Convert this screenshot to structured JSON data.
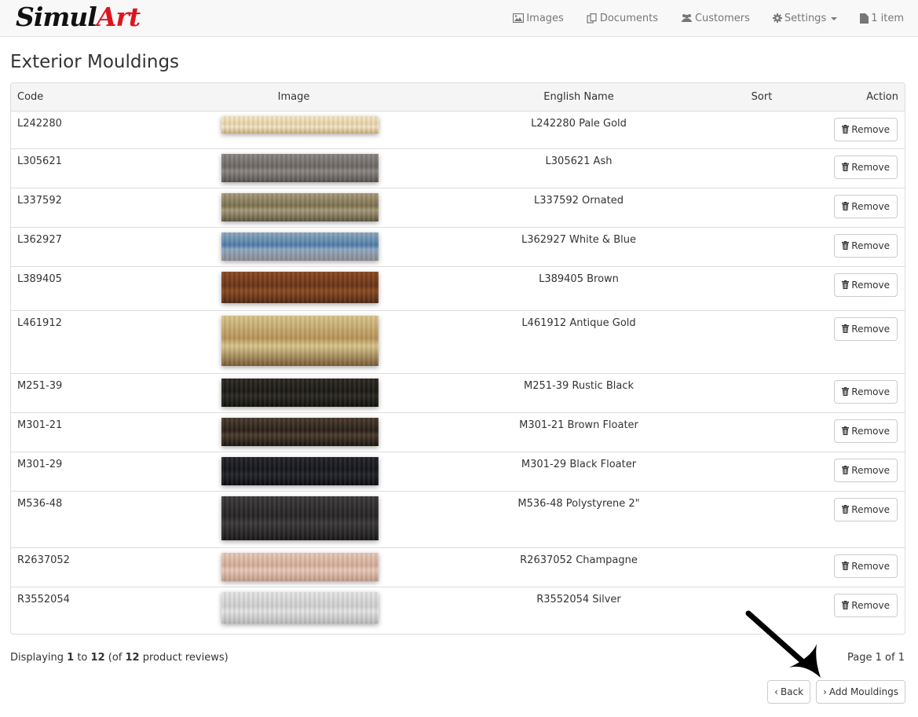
{
  "app": {
    "brand_part1": "Simul",
    "brand_part2": "Art",
    "brand_colors": {
      "part1": "#111111",
      "part2": "#e0141e"
    }
  },
  "nav": {
    "items": [
      {
        "label": "Images",
        "icon": "image-icon"
      },
      {
        "label": "Documents",
        "icon": "documents-icon"
      },
      {
        "label": "Customers",
        "icon": "users-icon"
      },
      {
        "label": "Settings",
        "icon": "gear-icon",
        "dropdown": true
      },
      {
        "label": "1 item",
        "icon": "file-icon"
      }
    ]
  },
  "page": {
    "title": "Exterior Mouldings"
  },
  "table": {
    "columns": [
      "Code",
      "Image",
      "English Name",
      "Sort",
      "Action"
    ],
    "remove_label": "Remove",
    "rows": [
      {
        "code": "L242280",
        "name": "L242280 Pale Gold",
        "sort": "",
        "swatch": [
          "#f3e6c8",
          "#e8d3a6",
          "#c9ad7a"
        ],
        "height": "short"
      },
      {
        "code": "L305621",
        "name": "L305621 Ash",
        "sort": "",
        "swatch": [
          "#8b8680",
          "#6b6762",
          "#55524e"
        ],
        "height": "mid"
      },
      {
        "code": "L337592",
        "name": "L337592 Ornated",
        "sort": "",
        "swatch": [
          "#a69a78",
          "#7d7050",
          "#5f5640"
        ],
        "height": "mid"
      },
      {
        "code": "L362927",
        "name": "L362927 White & Blue",
        "sort": "",
        "swatch": [
          "#8fa8c0",
          "#4f7ca8",
          "#8d8a8e"
        ],
        "height": "mid"
      },
      {
        "code": "L389405",
        "name": "L389405 Brown",
        "sort": "",
        "swatch": [
          "#8a4a22",
          "#6a3418",
          "#4e2a14"
        ],
        "height": "tall"
      },
      {
        "code": "L461912",
        "name": "L461912 Antique Gold",
        "sort": "",
        "swatch": [
          "#d8c48c",
          "#b89458",
          "#7a5a36"
        ],
        "height": "xtall"
      },
      {
        "code": "M251-39",
        "name": "M251-39 Rustic Black",
        "sort": "",
        "swatch": [
          "#2a2820",
          "#1c1a14",
          "#11100c"
        ],
        "height": "mid"
      },
      {
        "code": "M301-21",
        "name": "M301-21 Brown Floater",
        "sort": "",
        "swatch": [
          "#4a3a2e",
          "#2a2018",
          "#1a140e"
        ],
        "height": "mid"
      },
      {
        "code": "M301-29",
        "name": "M301-29 Black Floater",
        "sort": "",
        "swatch": [
          "#22242a",
          "#14161a",
          "#0c0d10"
        ],
        "height": "mid"
      },
      {
        "code": "M536-48",
        "name": "M536-48 Polystyrene 2\"",
        "sort": "",
        "swatch": [
          "#3a3838",
          "#262424",
          "#1a1818"
        ],
        "height": "xtall2"
      },
      {
        "code": "R2637052",
        "name": "R2637052 Champagne",
        "sort": "",
        "swatch": [
          "#e8c8b8",
          "#d4ac98",
          "#c09a88"
        ],
        "height": "mid"
      },
      {
        "code": "R3552054",
        "name": "R3552054 Silver",
        "sort": "",
        "swatch": [
          "#e4e4e4",
          "#cfcfcf",
          "#b8b8b8"
        ],
        "height": "tall"
      }
    ]
  },
  "footer": {
    "displaying_prefix": "Displaying ",
    "from": "1",
    "to_word": " to ",
    "to": "12",
    "of_prefix": " (of ",
    "total": "12",
    "suffix": " product reviews)",
    "page_info": "Page 1 of 1",
    "back_label": "Back",
    "add_label": "Add Mouldings"
  }
}
